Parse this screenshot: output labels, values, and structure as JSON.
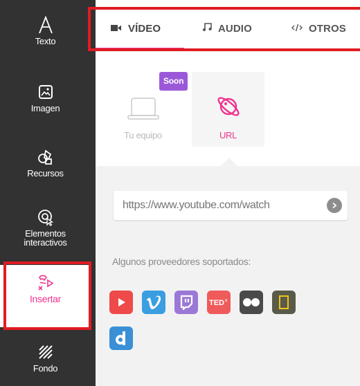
{
  "sidebar": {
    "items": [
      {
        "label": "Texto",
        "icon": "text-icon"
      },
      {
        "label": "Imagen",
        "icon": "image-icon"
      },
      {
        "label": "Recursos",
        "icon": "resources-icon"
      },
      {
        "label": "Elementos interactivos",
        "icon": "interactive-elements-icon"
      },
      {
        "label": "Insertar",
        "icon": "insert-icon",
        "active": true
      },
      {
        "label": "Fondo",
        "icon": "background-icon"
      }
    ]
  },
  "tabs": [
    {
      "label": "VÍDEO",
      "icon": "video-camera-icon",
      "active": true
    },
    {
      "label": "AUDIO",
      "icon": "music-note-icon"
    },
    {
      "label": "OTROS",
      "icon": "code-icon"
    }
  ],
  "sources": [
    {
      "label": "Tu equipo",
      "icon": "laptop-icon",
      "badge": "Soon",
      "disabled": true
    },
    {
      "label": "URL",
      "icon": "planet-icon",
      "selected": true
    }
  ],
  "url_input": {
    "placeholder": "https://www.youtube.com/watch",
    "value": ""
  },
  "providers": {
    "label": "Algunos proveedores soportados:",
    "items": [
      {
        "name": "YouTube",
        "icon": "youtube-icon",
        "color": "#ee4a4a"
      },
      {
        "name": "Vimeo",
        "icon": "vimeo-icon",
        "color": "#3a9ee0"
      },
      {
        "name": "Twitch",
        "icon": "twitch-icon",
        "color": "#9b78d6"
      },
      {
        "name": "TED",
        "icon": "ted-icon",
        "color": "#ef5b5b"
      },
      {
        "name": "Flickr",
        "icon": "flickr-icon",
        "color": "#4a4a4a"
      },
      {
        "name": "Generic",
        "icon": "frame-icon",
        "color": "#5a5a4a"
      },
      {
        "name": "Dailymotion",
        "icon": "dailymotion-icon",
        "color": "#3a8fd6"
      }
    ]
  },
  "colors": {
    "accent": "#f0338f",
    "sidebar_bg": "#323232",
    "highlight_border": "#e11b22",
    "soon_badge": "#9b59d9"
  }
}
